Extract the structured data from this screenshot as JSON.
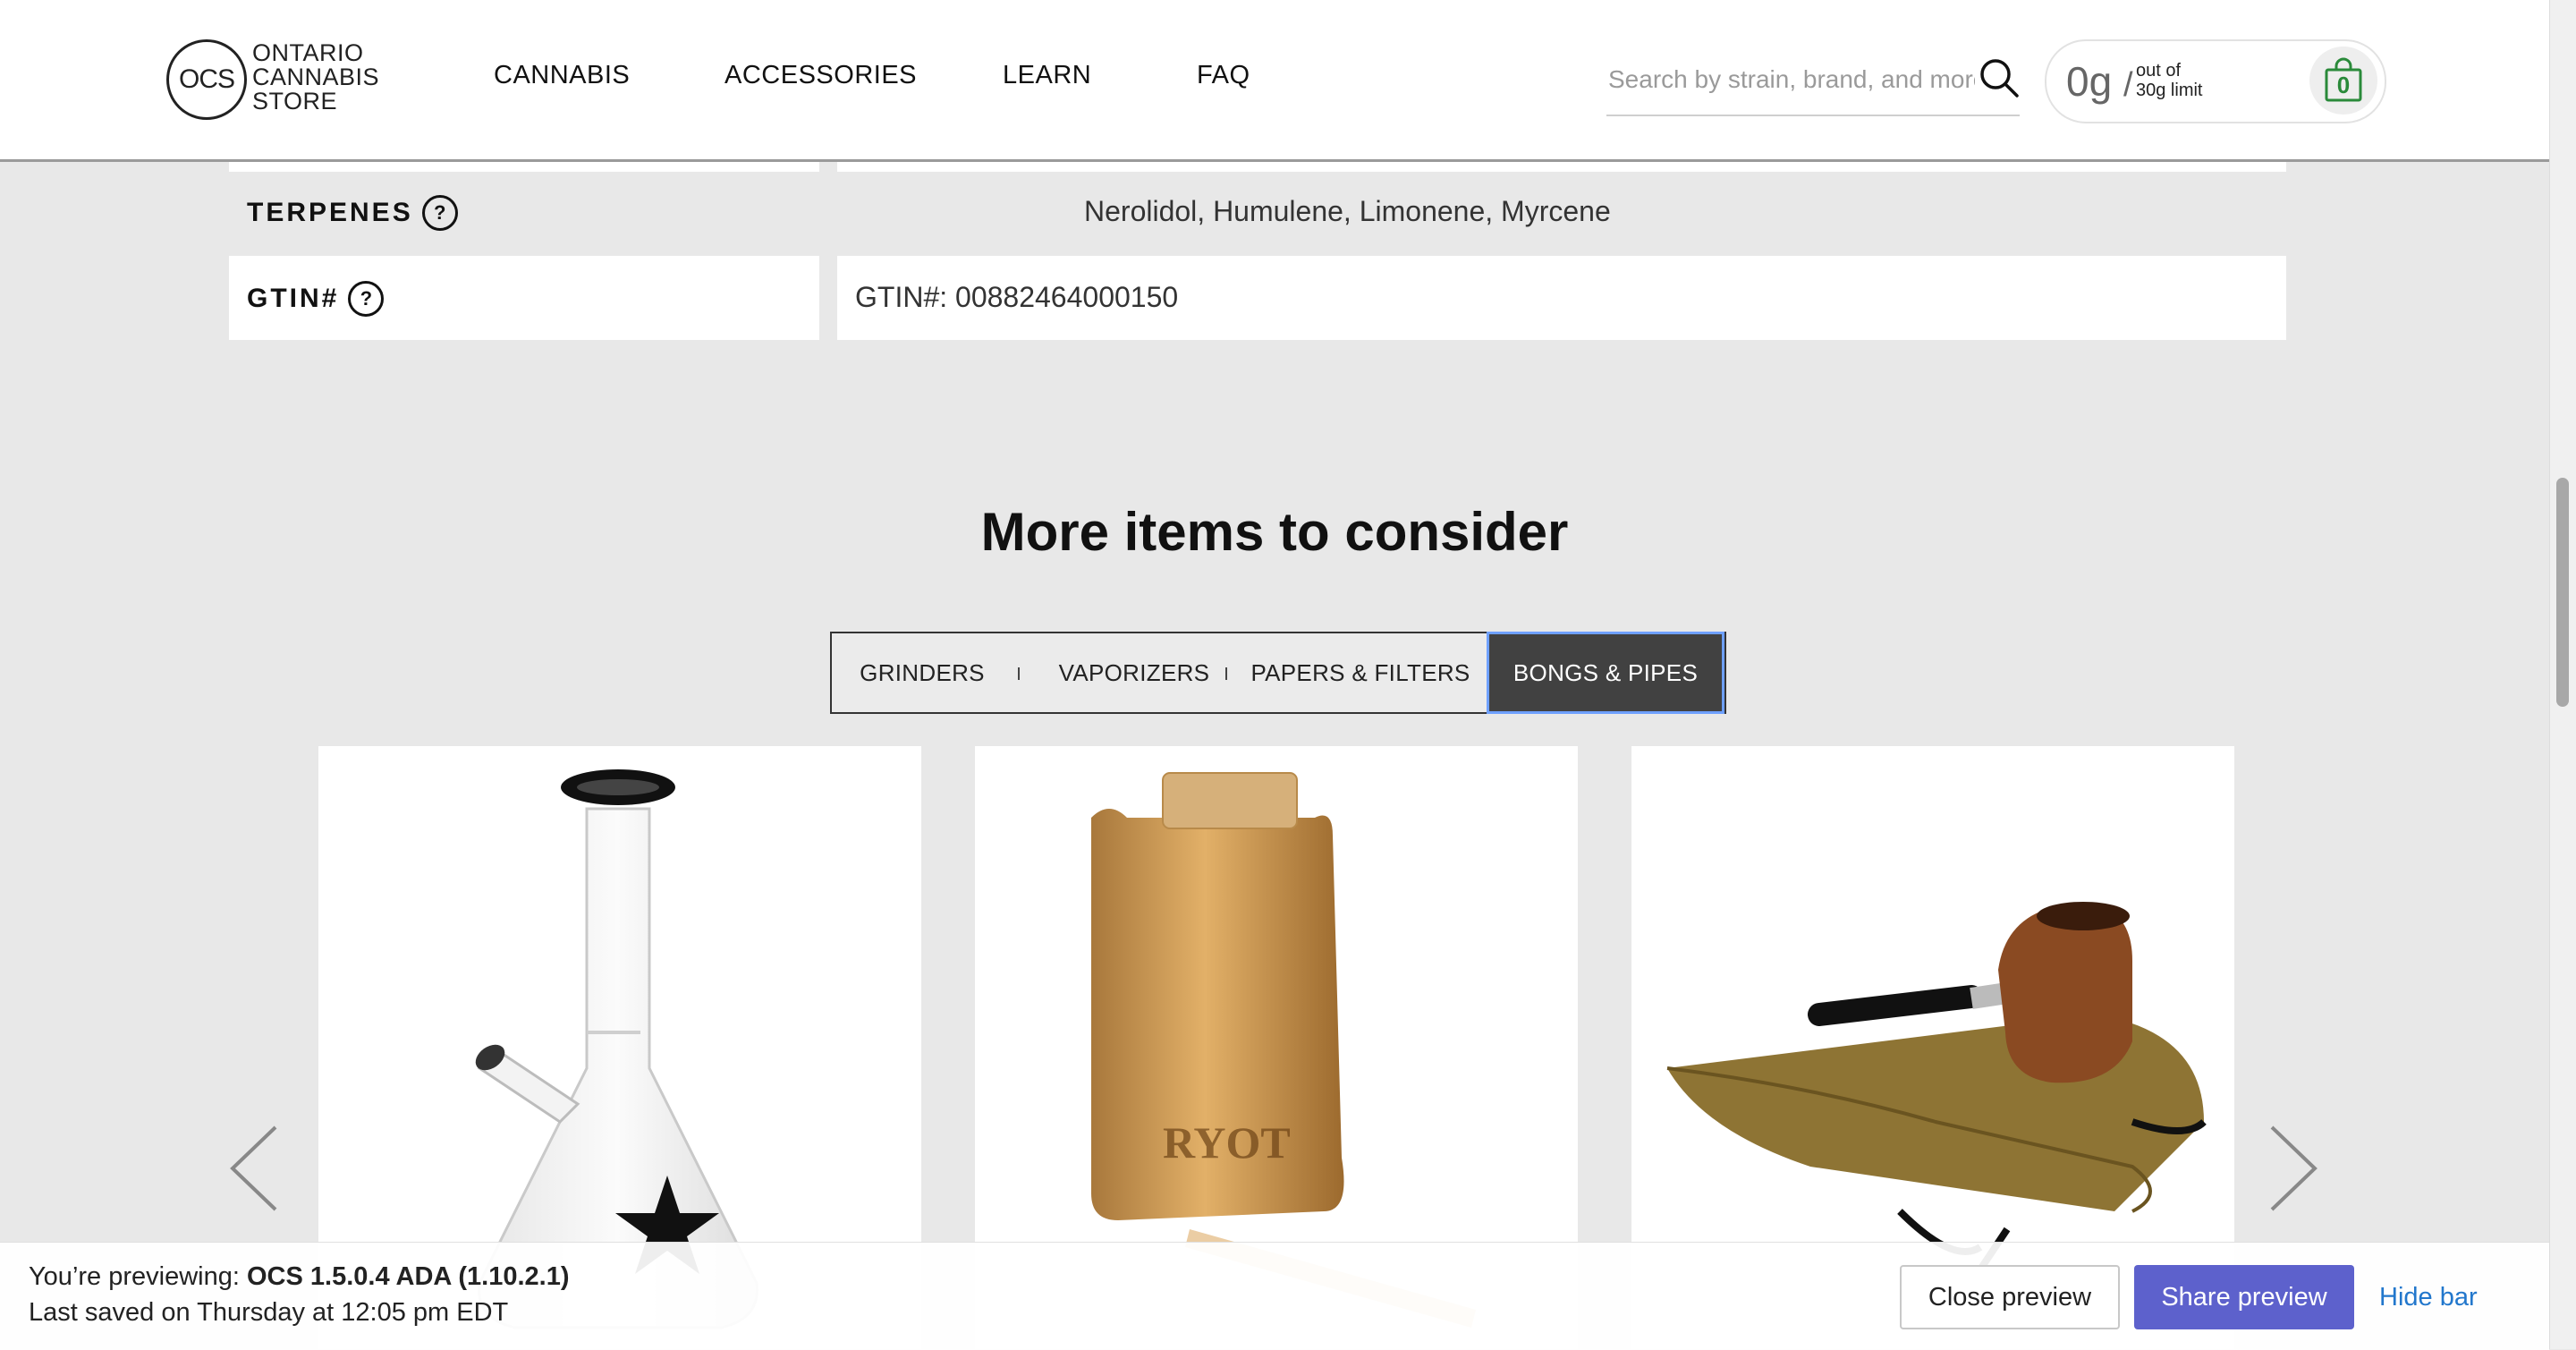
{
  "header": {
    "logo_abbrev": "OCS",
    "logo_lines": [
      "ONTARIO",
      "CANNABIS",
      "STORE"
    ],
    "nav": [
      "CANNABIS",
      "ACCESSORIES",
      "LEARN",
      "FAQ"
    ],
    "search_placeholder": "Search by strain, brand, and more",
    "limit_amount": "0g",
    "limit_sep": "/",
    "limit_sub_1": "out of",
    "limit_sub_2": "30g limit",
    "cart_count": "0"
  },
  "specs": [
    {
      "label": "TERPENES",
      "help": "?",
      "value": "Nerolidol, Humulene, Limonene, Myrcene"
    },
    {
      "label": "GTIN#",
      "help": "?",
      "value": "GTIN#: 00882464000150"
    }
  ],
  "section": {
    "title": "More items to consider",
    "tabs": [
      "GRINDERS",
      "VAPORIZERS",
      "PAPERS & FILTERS",
      "BONGS & PIPES"
    ],
    "active_tab": "BONGS & PIPES"
  },
  "products": [
    {
      "icon": "glass-bong-image"
    },
    {
      "icon": "wooden-dugout-image",
      "brand_mark": "RYOT"
    },
    {
      "icon": "wooden-pipe-image"
    }
  ],
  "preview_bar": {
    "previewing_prefix": "You’re previewing:",
    "previewing_name": "OCS 1.5.0.4 ADA (1.10.2.1)",
    "last_saved": "Last saved on Thursday at 12:05 pm EDT",
    "close_label": "Close preview",
    "share_label": "Share preview",
    "hide_label": "Hide bar"
  },
  "colors": {
    "accent_share": "#5d61cc",
    "link_blue": "#2277cc",
    "cart_green": "#2a8a3a",
    "active_tab_bg": "#414141",
    "active_tab_border": "#6ea0ff"
  }
}
